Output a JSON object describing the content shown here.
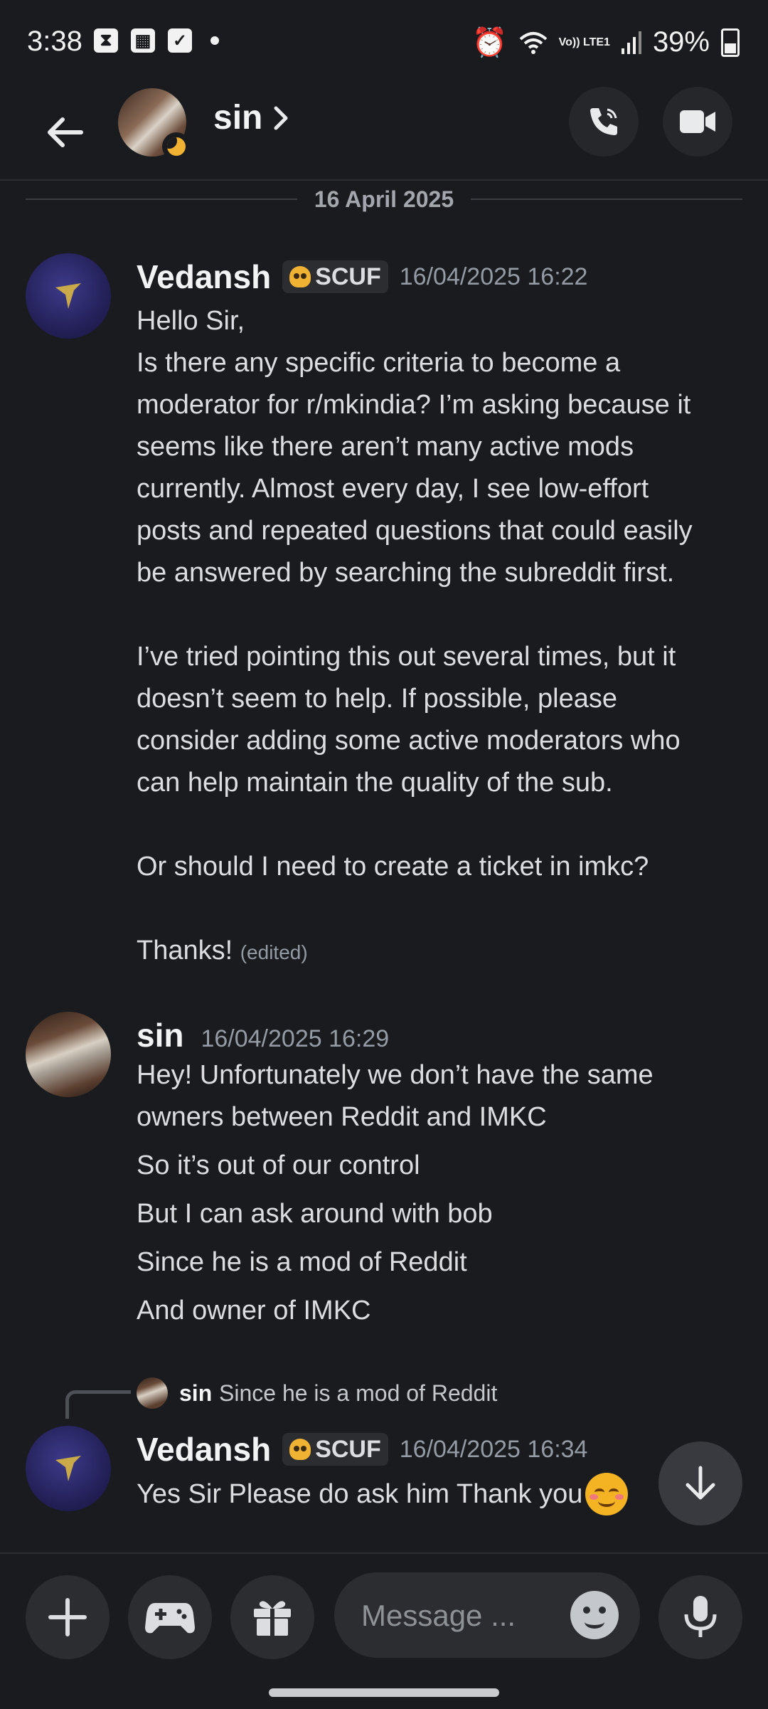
{
  "status_bar": {
    "time": "3:38",
    "network": "Vo)) LTE1",
    "battery": "39%"
  },
  "header": {
    "contact_name": "sin"
  },
  "date_divider": "16 April 2025",
  "messages": [
    {
      "author": "Vedansh",
      "tag": "SCUF",
      "timestamp": "16/04/2025 16:22",
      "text": "Hello Sir,\nIs there any specific criteria to become a\nmoderator for r/mkindia? I’m asking because it\nseems like there aren’t many active mods\ncurrently. Almost every day, I see low-effort\nposts and repeated questions that could easily\nbe answered by searching the subreddit first.\n\nI’ve tried pointing this out several times, but it\ndoesn’t seem to help. If possible, please\nconsider adding some active moderators who\ncan help maintain the quality of the sub.\n\nOr should I need to create a ticket in imkc?\n\nThanks! ",
      "edited": "(edited)"
    },
    {
      "author": "sin",
      "timestamp": "16/04/2025 16:29",
      "lines": [
        "Hey! Unfortunately we don’t have the same",
        "owners between Reddit and IMKC",
        "So it’s out of our control",
        "But I can ask around with bob",
        "Since he is a mod of Reddit",
        "And owner of IMKC"
      ]
    },
    {
      "reply_to": {
        "author": "sin",
        "text": "Since he is a mod of Reddit"
      },
      "author": "Vedansh",
      "tag": "SCUF",
      "timestamp": "16/04/2025 16:34",
      "text": "Yes Sir Please do ask him Thank you"
    }
  ],
  "composer": {
    "placeholder": "Message ..."
  }
}
